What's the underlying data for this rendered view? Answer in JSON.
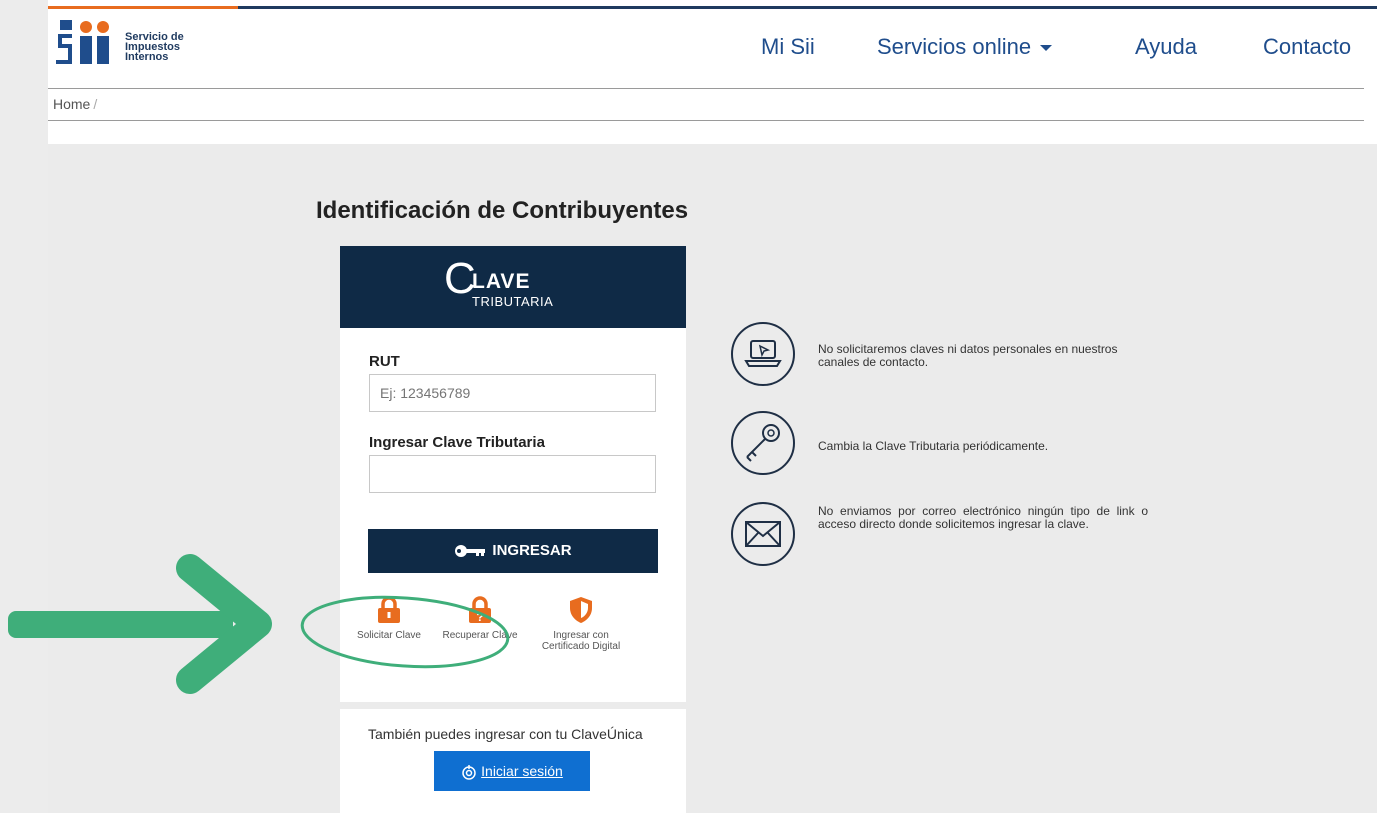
{
  "header": {
    "logo_lines": [
      "Servicio de",
      "Impuestos",
      "Internos"
    ],
    "nav": [
      "Mi Sii",
      "Servicios online",
      "Ayuda",
      "Contacto"
    ]
  },
  "breadcrumb": {
    "home": "Home",
    "separator": "/"
  },
  "page_title": "Identificación de Contribuyentes",
  "login": {
    "brand_c": "C",
    "brand_lave": "LAVE",
    "brand_sub": "TRIBUTARIA",
    "rut_label": "RUT",
    "rut_placeholder": "Ej: 123456789",
    "password_label": "Ingresar Clave Tributaria",
    "submit_label": "INGRESAR",
    "options": [
      {
        "label": "Solicitar Clave",
        "icon": "lock-icon"
      },
      {
        "label": "Recuperar Clave",
        "icon": "lock-question-icon"
      },
      {
        "label": "Ingresar con Certificado Digital",
        "icon": "shield-icon"
      }
    ]
  },
  "clave_unica": {
    "text": "También puedes ingresar con tu ClaveÚnica",
    "button_label": "Iniciar sesión"
  },
  "tips": [
    {
      "icon": "laptop-icon",
      "text": "No solicitaremos claves ni datos personales en nuestros canales de contacto."
    },
    {
      "icon": "key-icon",
      "text": "Cambia la Clave Tributaria periódicamente."
    },
    {
      "icon": "envelope-icon",
      "text": "No enviamos por correo electrónico ningún tipo de link o acceso directo donde solicitemos ingresar la clave."
    }
  ],
  "colors": {
    "navy": "#0f2a46",
    "orange": "#e86c1f",
    "annotation_green": "#3fae7a",
    "link_blue": "#1f4d8c"
  }
}
